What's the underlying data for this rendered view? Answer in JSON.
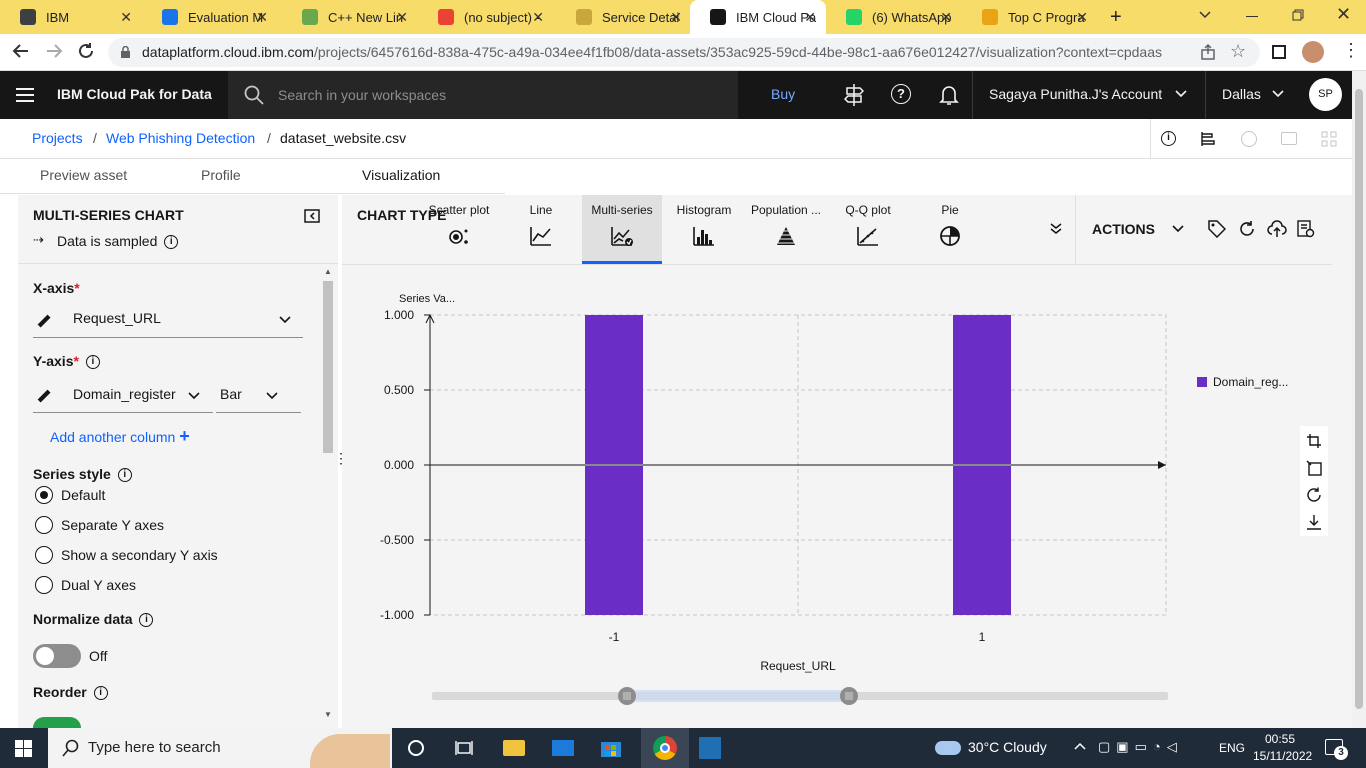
{
  "browser": {
    "tabs": [
      {
        "title": "IBM",
        "favicon_color": "#3c4043",
        "x": 0,
        "w": 142
      },
      {
        "title": "Evaluation M",
        "favicon_color": "#1a73e8",
        "x": 142,
        "w": 136
      },
      {
        "title": "C++ New Lin",
        "favicon_color": "#6aa84f",
        "x": 282,
        "w": 136
      },
      {
        "title": "(no subject) -",
        "favicon_color": "#ea4335",
        "x": 418,
        "w": 136
      },
      {
        "title": "Service Detai",
        "favicon_color": "#c8a83c",
        "x": 556,
        "w": 136
      },
      {
        "title": "IBM Cloud Pa",
        "favicon_color": "#161616",
        "x": 690,
        "w": 136
      },
      {
        "title": "(6) WhatsApp",
        "favicon_color": "#25d366",
        "x": 826,
        "w": 136
      },
      {
        "title": "Top C Progra",
        "favicon_color": "#e8a317",
        "x": 962,
        "w": 136
      }
    ],
    "active_tab_index": 5,
    "url_host": "dataplatform.cloud.ibm.com",
    "url_path": "/projects/6457616d-838a-475c-a49a-034ee4f1fb08/data-assets/353ac925-59cd-44be-98c1-aa676e012427/visualization?context=cpdaas"
  },
  "header": {
    "product": "IBM Cloud Pak for Data",
    "search_placeholder": "Search in your workspaces",
    "buy": "Buy",
    "account": "Sagaya Punitha.J's Account",
    "region": "Dallas",
    "avatar": "SP"
  },
  "breadcrumb": {
    "projects": "Projects",
    "sep": "/",
    "project": "Web Phishing Detection",
    "file": "dataset_website.csv"
  },
  "asset_tabs": [
    "Preview asset",
    "Profile",
    "Visualization"
  ],
  "left": {
    "title": "MULTI-SERIES CHART",
    "sampled": "Data is sampled",
    "xaxis_label": "X-axis",
    "xaxis_value": "Request_URL",
    "yaxis_label": "Y-axis",
    "yaxis_value": "Domain_register",
    "yaxis_type": "Bar",
    "add_column": "Add another column",
    "series_style_label": "Series style",
    "series_options": [
      "Default",
      "Separate Y axes",
      "Show a secondary Y axis",
      "Dual Y axes"
    ],
    "series_selected": 0,
    "normalize_label": "Normalize data",
    "normalize_state": "Off",
    "reorder_label": "Reorder",
    "required_mark": "*"
  },
  "toolbar": {
    "chart_type_label": "CHART TYPE",
    "types": [
      "Scatter plot",
      "Line",
      "Multi-series",
      "Histogram",
      "Population ...",
      "Q-Q plot",
      "Pie"
    ],
    "selected_type": 2,
    "actions": "ACTIONS"
  },
  "chart_data": {
    "type": "bar",
    "categories": [
      "-1",
      "1"
    ],
    "series": [
      {
        "name": "Domain_reg...",
        "values": [
          1.0,
          1.0
        ],
        "color": "#6a2ec7"
      }
    ],
    "bar_range": [
      [
        -1.0,
        1.0
      ],
      [
        -1.0,
        1.0
      ]
    ],
    "ylabel": "Series Va...",
    "xlabel": "Request_URL",
    "yticks": [
      "1.000",
      "0.500",
      "0.000",
      "-0.500",
      "-1.000"
    ],
    "ylim": [
      -1,
      1
    ],
    "grid": true,
    "legend": "right"
  },
  "taskbar": {
    "search": "Type here to search",
    "weather": "30°C  Cloudy",
    "lang": "ENG",
    "time": "00:55",
    "date": "15/11/2022",
    "notifications": "3"
  }
}
